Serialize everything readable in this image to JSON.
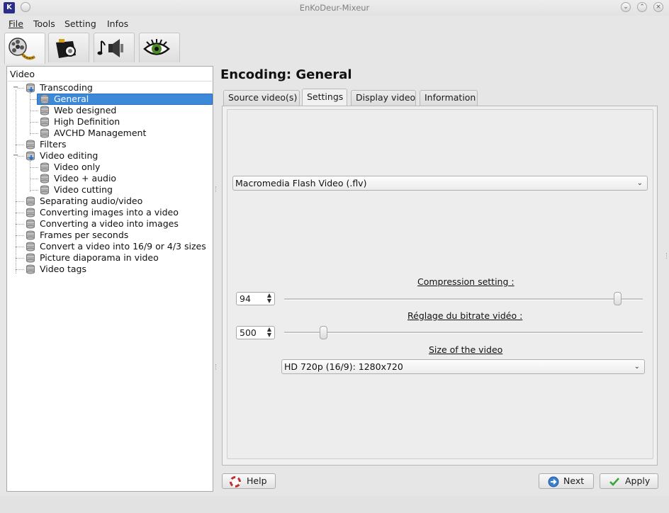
{
  "window": {
    "title": "EnKoDeur-Mixeur",
    "app_icon_glyph": "K",
    "controls": [
      "minimize-icon",
      "maximize-icon",
      "close-icon"
    ]
  },
  "menu": {
    "items": [
      {
        "label": "File",
        "mnemonic": "F"
      },
      {
        "label": "Tools",
        "mnemonic": "T"
      },
      {
        "label": "Setting",
        "mnemonic": "S"
      },
      {
        "label": "Infos",
        "mnemonic": "I"
      }
    ]
  },
  "toolbar": {
    "buttons": [
      {
        "icon": "film-reel-icon",
        "active": true
      },
      {
        "icon": "camera-icon",
        "active": false
      },
      {
        "icon": "audio-speaker-icon",
        "active": false
      },
      {
        "icon": "eye-icon",
        "active": false
      }
    ]
  },
  "tree": {
    "header": "Video",
    "items": [
      {
        "label": "Transcoding",
        "level": 0,
        "expandable": true,
        "expanded": true
      },
      {
        "label": "General",
        "level": 1,
        "selected": true
      },
      {
        "label": "Web designed",
        "level": 1
      },
      {
        "label": "High Definition",
        "level": 1
      },
      {
        "label": "AVCHD Management",
        "level": 1
      },
      {
        "label": "Filters",
        "level": 0
      },
      {
        "label": "Video editing",
        "level": 0,
        "expandable": true,
        "expanded": true
      },
      {
        "label": "Video only",
        "level": 1
      },
      {
        "label": "Video + audio",
        "level": 1
      },
      {
        "label": "Video cutting",
        "level": 1
      },
      {
        "label": "Separating audio/video",
        "level": 0
      },
      {
        "label": "Converting images into a video",
        "level": 0
      },
      {
        "label": "Converting a video into images",
        "level": 0
      },
      {
        "label": "Frames per seconds",
        "level": 0
      },
      {
        "label": "Convert a video into 16/9 or 4/3 sizes",
        "level": 0
      },
      {
        "label": "Picture diaporama in video",
        "level": 0
      },
      {
        "label": "Video tags",
        "level": 0
      }
    ]
  },
  "main": {
    "title": "Encoding: General",
    "tabs": [
      {
        "label": "Source video(s)",
        "active": false
      },
      {
        "label": "Settings",
        "active": true
      },
      {
        "label": "Display video",
        "active": false
      },
      {
        "label": "Information",
        "active": false
      }
    ],
    "format_select": {
      "value": "Macromedia Flash Video (.flv)"
    },
    "compression": {
      "label": "Compression setting :",
      "value": "94",
      "slider_fraction": 0.94
    },
    "bitrate": {
      "label": "Réglage du bitrate vidéo :",
      "value": "500",
      "slider_fraction": 0.1
    },
    "size": {
      "label": "Size of the video",
      "value": "HD 720p (16/9): 1280x720"
    }
  },
  "buttons": {
    "help": {
      "label": "Help",
      "icon": "lifebuoy-icon"
    },
    "next": {
      "label": "Next",
      "icon": "next-arrow-icon"
    },
    "apply": {
      "label": "Apply",
      "icon": "checkmark-icon"
    }
  },
  "colors": {
    "selection": "#3b89d8",
    "window_bg": "#e6e6e6"
  }
}
